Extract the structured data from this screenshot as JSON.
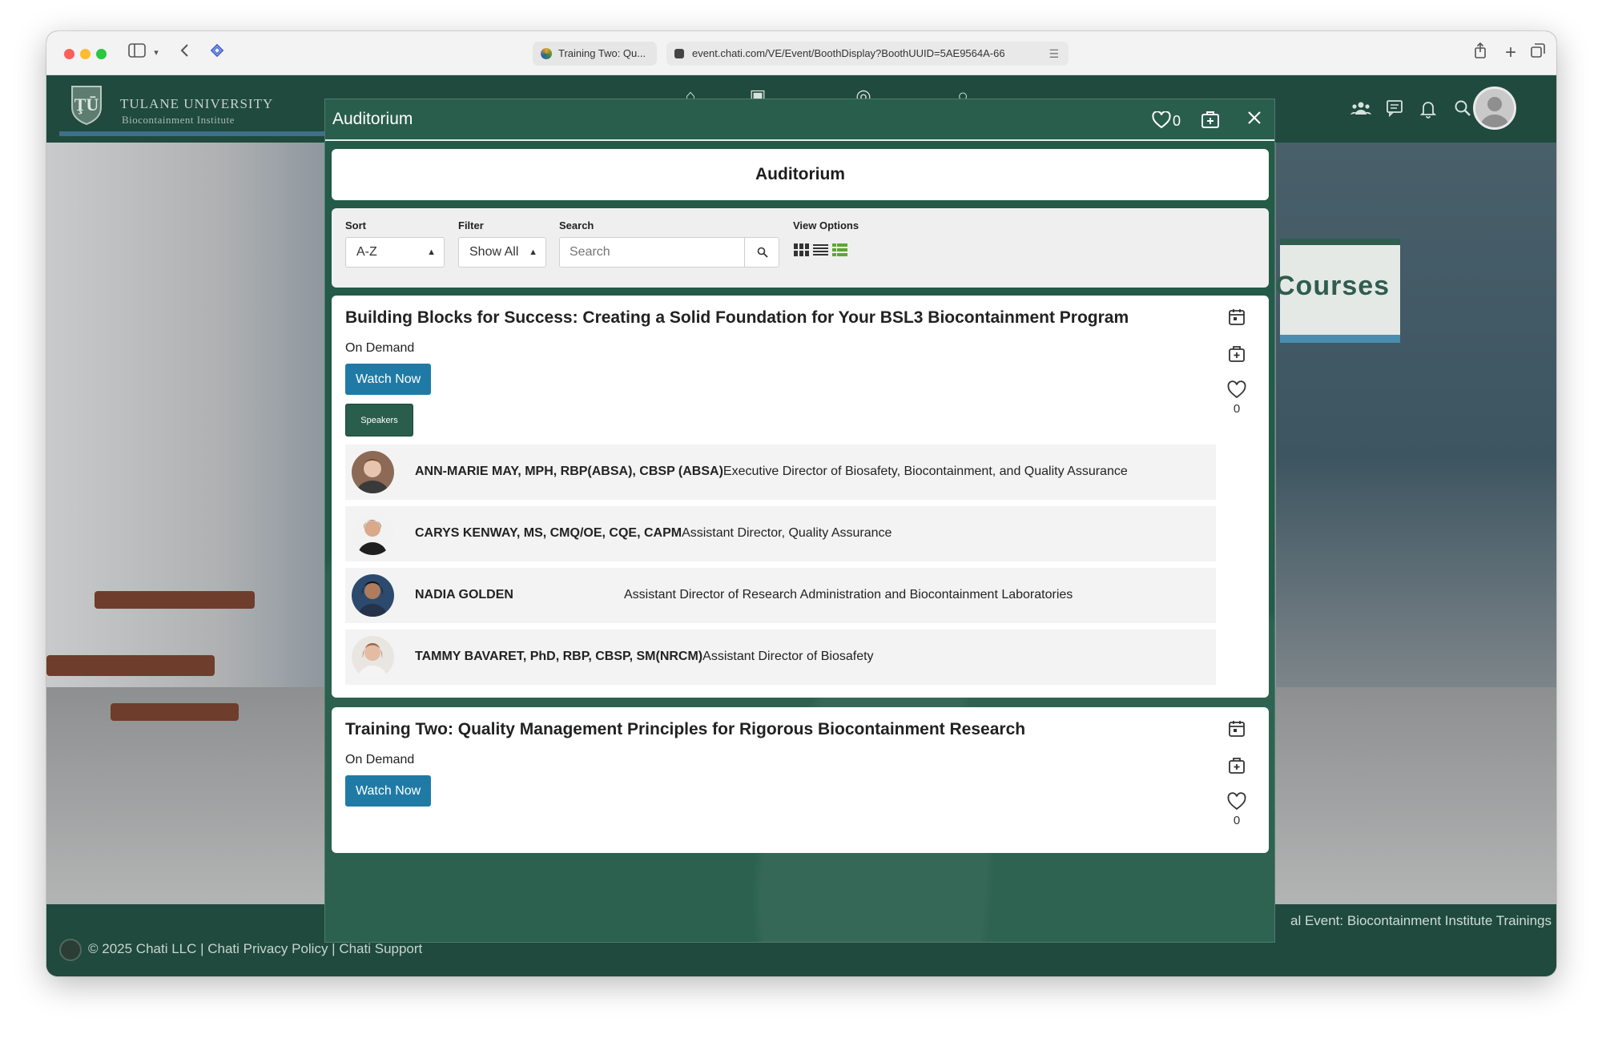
{
  "browser": {
    "tab_title": "Training Two: Qu...",
    "url": "event.chati.com/VE/Event/BoothDisplay?BoothUUID=5AE9564A-66"
  },
  "header": {
    "logo_line1": "TULANE UNIVERSITY",
    "logo_line2": "Biocontainment Institute"
  },
  "scene": {
    "sign_text": "Courses",
    "event_text": "al Event: Biocontainment Institute Trainings"
  },
  "footer": {
    "copyright": "© 2025 Chati LLC | Chati Privacy Policy | Chati Support"
  },
  "modal": {
    "header_title": "Auditorium",
    "favorites_count": "0",
    "panel_title": "Auditorium",
    "controls": {
      "sort_label": "Sort",
      "sort_value": "A-Z",
      "filter_label": "Filter",
      "filter_value": "Show All",
      "search_label": "Search",
      "search_placeholder": "Search",
      "view_options_label": "View Options"
    },
    "sessions": [
      {
        "title": "Building Blocks for Success: Creating a Solid Foundation for Your BSL3 Biocontainment Program",
        "status": "On Demand",
        "watch_label": "Watch Now",
        "speakers_label": "Speakers",
        "likes": "0",
        "speakers": [
          {
            "name": "ANN-MARIE MAY, MPH, RBP(ABSA), CBSP (ABSA)",
            "role": "Executive Director of Biosafety, Biocontainment, and Quality Assurance"
          },
          {
            "name": "CARYS KENWAY, MS, CMQ/OE, CQE, CAPM",
            "role": "Assistant Director, Quality Assurance"
          },
          {
            "name": "NADIA GOLDEN",
            "role": "Assistant Director of Research Administration and Biocontainment Laboratories"
          },
          {
            "name": "TAMMY BAVARET, PhD, RBP, CBSP, SM(NRCM)",
            "role": "Assistant Director of Biosafety"
          }
        ]
      },
      {
        "title": "Training Two: Quality Management Principles for Rigorous Biocontainment Research",
        "status": "On Demand",
        "watch_label": "Watch Now",
        "likes": "0"
      }
    ]
  },
  "colors": {
    "brand_green": "#1f4a3d",
    "modal_green": "#2a5e4c",
    "watch_blue": "#1f7ba6",
    "list_view_green": "#5aa832"
  }
}
